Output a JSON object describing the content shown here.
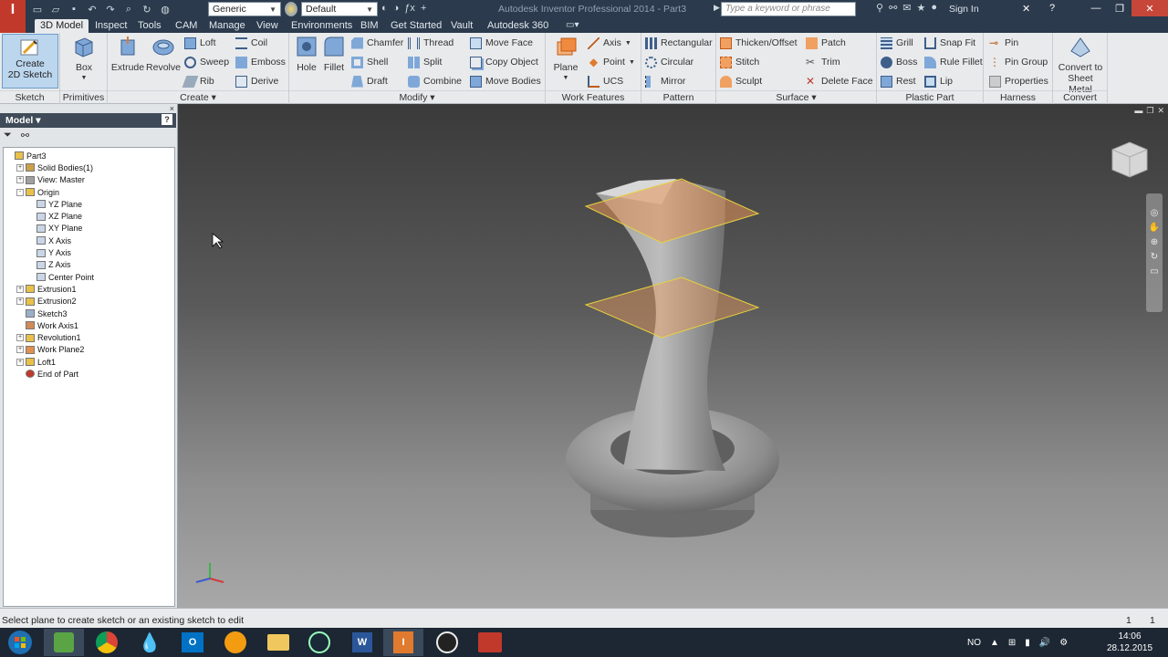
{
  "app": {
    "title": "Autodesk Inventor Professional 2014 - Part3",
    "logo_text": "I",
    "logo_sub": "PRO",
    "search_placeholder": "Type a keyword or phrase",
    "sign_in": "Sign In",
    "material_combo": "Generic",
    "appearance_combo": "Default"
  },
  "tabs": [
    "3D Model",
    "Inspect",
    "Tools",
    "CAM",
    "Manage",
    "View",
    "Environments",
    "BIM",
    "Get Started",
    "Vault",
    "Autodesk 360"
  ],
  "ribbon": {
    "sketch": {
      "label": "Sketch",
      "create_line1": "Create",
      "create_line2": "2D Sketch"
    },
    "primitives": {
      "label": "Primitives",
      "box": "Box"
    },
    "create": {
      "label": "Create ▾",
      "extrude": "Extrude",
      "revolve": "Revolve",
      "loft": "Loft",
      "sweep": "Sweep",
      "rib": "Rib",
      "coil": "Coil",
      "emboss": "Emboss",
      "derive": "Derive"
    },
    "modify": {
      "label": "Modify ▾",
      "hole": "Hole",
      "fillet": "Fillet",
      "chamfer": "Chamfer",
      "shell": "Shell",
      "draft": "Draft",
      "thread": "Thread",
      "split": "Split",
      "combine": "Combine",
      "move_face": "Move Face",
      "copy_object": "Copy Object",
      "move_bodies": "Move Bodies"
    },
    "work_features": {
      "label": "Work Features",
      "plane": "Plane",
      "axis": "Axis",
      "point": "Point",
      "ucs": "UCS"
    },
    "pattern": {
      "label": "Pattern",
      "rectangular": "Rectangular",
      "circular": "Circular",
      "mirror": "Mirror"
    },
    "surface": {
      "label": "Surface ▾",
      "thicken": "Thicken/Offset",
      "stitch": "Stitch",
      "sculpt": "Sculpt",
      "patch": "Patch",
      "trim": "Trim",
      "delete_face": "Delete Face"
    },
    "plastic": {
      "label": "Plastic Part",
      "grill": "Grill",
      "boss": "Boss",
      "rest": "Rest",
      "snap_fit": "Snap Fit",
      "rule_fillet": "Rule Fillet",
      "lip": "Lip"
    },
    "harness": {
      "label": "Harness",
      "pin": "Pin",
      "pin_group": "Pin Group",
      "properties": "Properties"
    },
    "convert": {
      "label": "Convert",
      "line1": "Convert to",
      "line2": "Sheet Metal"
    }
  },
  "browser": {
    "title": "Model ▾",
    "help": "?",
    "tree": [
      {
        "label": "Part3",
        "indent": 0,
        "expander": "",
        "icon": "part"
      },
      {
        "label": "Solid Bodies(1)",
        "indent": 1,
        "expander": "+",
        "icon": "bodies"
      },
      {
        "label": "View: Master",
        "indent": 1,
        "expander": "+",
        "icon": "view"
      },
      {
        "label": "Origin",
        "indent": 1,
        "expander": "-",
        "icon": "folder"
      },
      {
        "label": "YZ Plane",
        "indent": 2,
        "expander": "",
        "icon": "plane"
      },
      {
        "label": "XZ Plane",
        "indent": 2,
        "expander": "",
        "icon": "plane"
      },
      {
        "label": "XY Plane",
        "indent": 2,
        "expander": "",
        "icon": "plane"
      },
      {
        "label": "X Axis",
        "indent": 2,
        "expander": "",
        "icon": "axis"
      },
      {
        "label": "Y Axis",
        "indent": 2,
        "expander": "",
        "icon": "axis"
      },
      {
        "label": "Z Axis",
        "indent": 2,
        "expander": "",
        "icon": "axis"
      },
      {
        "label": "Center Point",
        "indent": 2,
        "expander": "",
        "icon": "point"
      },
      {
        "label": "Extrusion1",
        "indent": 1,
        "expander": "+",
        "icon": "feature"
      },
      {
        "label": "Extrusion2",
        "indent": 1,
        "expander": "+",
        "icon": "feature"
      },
      {
        "label": "Sketch3",
        "indent": 1,
        "expander": "",
        "icon": "sketch"
      },
      {
        "label": "Work Axis1",
        "indent": 1,
        "expander": "",
        "icon": "workaxis"
      },
      {
        "label": "Revolution1",
        "indent": 1,
        "expander": "+",
        "icon": "feature"
      },
      {
        "label": "Work Plane2",
        "indent": 1,
        "expander": "+",
        "icon": "workplane"
      },
      {
        "label": "Loft1",
        "indent": 1,
        "expander": "+",
        "icon": "feature"
      },
      {
        "label": "End of Part",
        "indent": 1,
        "expander": "",
        "icon": "end"
      }
    ]
  },
  "status": {
    "text": "Select plane to create sketch or an existing sketch to edit",
    "n1": "1",
    "n2": "1"
  },
  "taskbar": {
    "apps": [
      "start",
      "installer",
      "chrome",
      "drop",
      "outlook",
      "vlc",
      "explorer",
      "steam",
      "word",
      "inventor",
      "obs",
      "game"
    ],
    "lang": "NO",
    "time": "14:06",
    "date": "28.12.2015"
  },
  "colors": {
    "titlebar": "#2b3a4c",
    "ribbon": "#e8eaec",
    "accent_orange": "#e07a2e",
    "work_plane_edge": "#e7d23c"
  }
}
